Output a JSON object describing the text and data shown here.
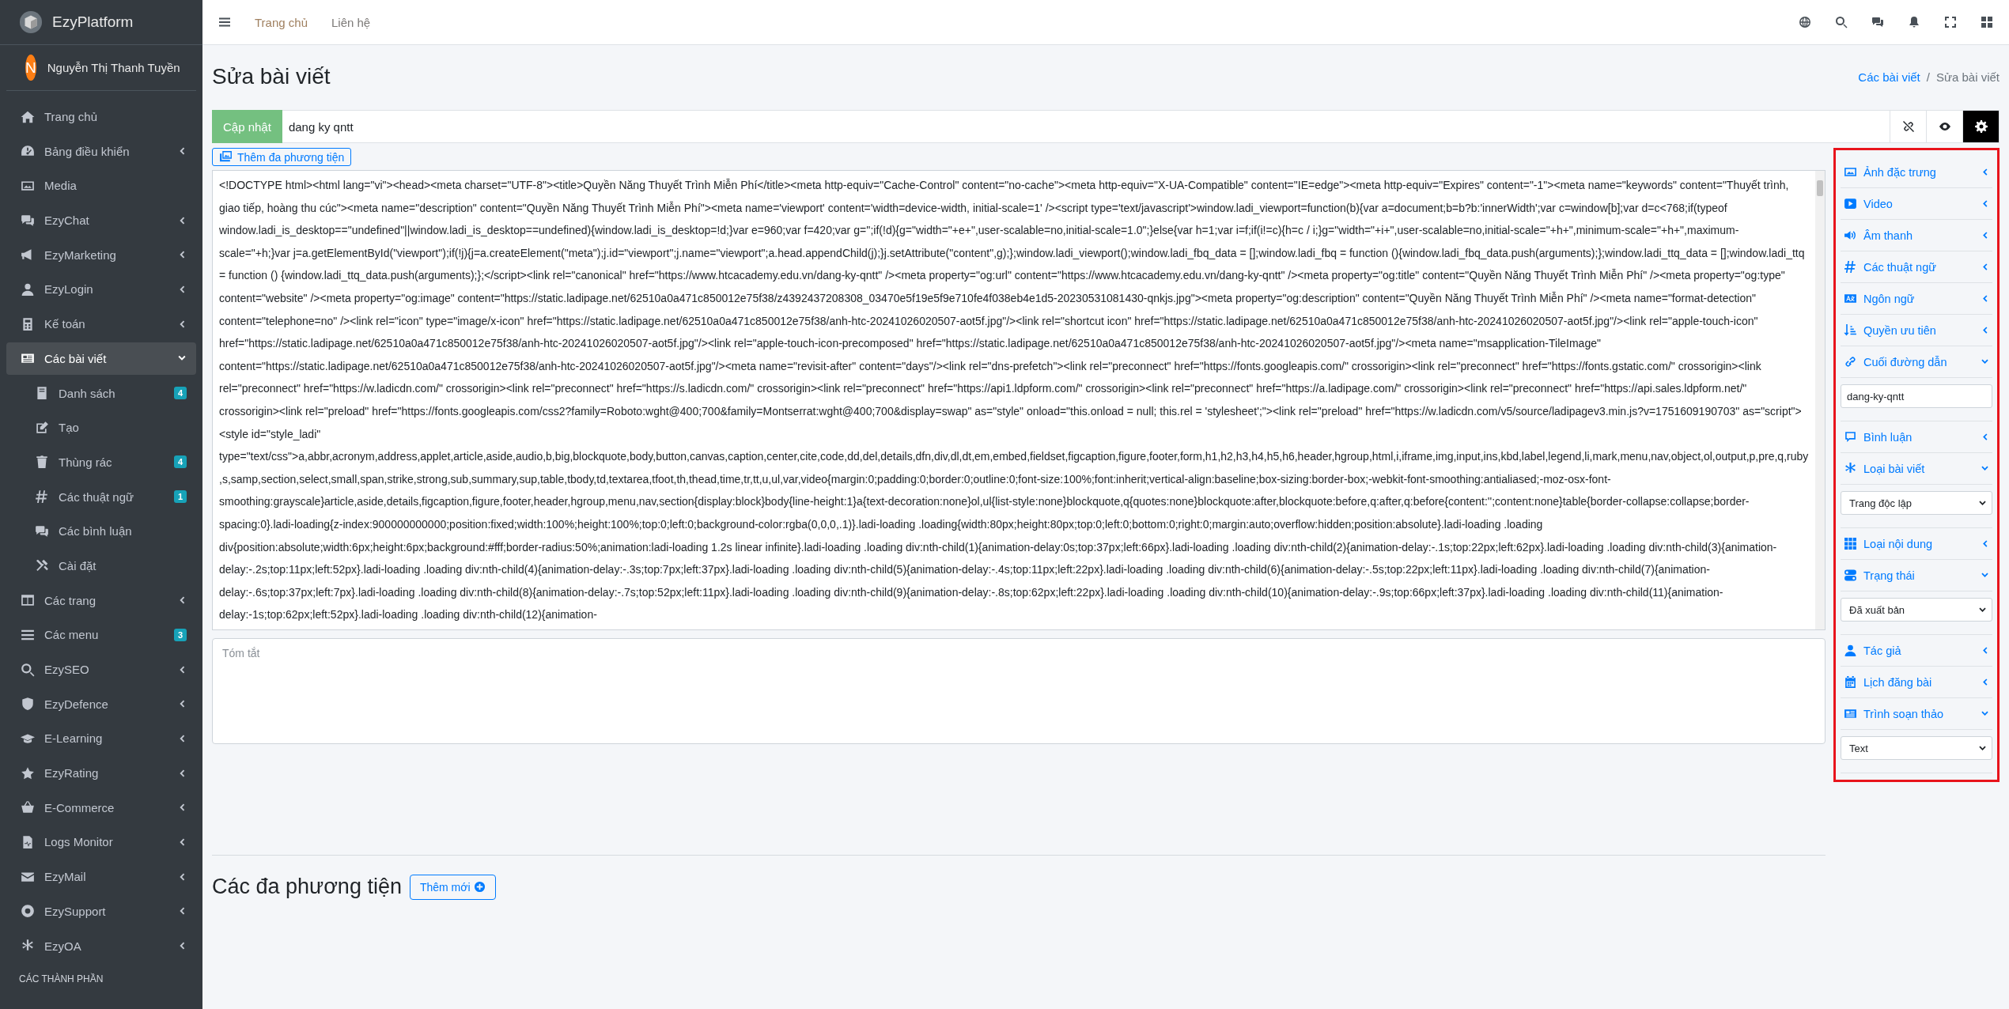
{
  "brand": {
    "name": "EzyPlatform"
  },
  "user": {
    "initial": "N",
    "name": "Nguyễn Thị Thanh Tuyền"
  },
  "sidebar": {
    "items": [
      {
        "label": "Trang chủ",
        "expandable": false,
        "expanded": false,
        "selected": false
      },
      {
        "label": "Bảng điều khiển",
        "expandable": true,
        "expanded": false,
        "selected": false
      },
      {
        "label": "Media",
        "expandable": false,
        "expanded": false,
        "selected": false
      },
      {
        "label": "EzyChat",
        "expandable": true,
        "expanded": false,
        "selected": false
      },
      {
        "label": "EzyMarketing",
        "expandable": true,
        "expanded": false,
        "selected": false
      },
      {
        "label": "EzyLogin",
        "expandable": true,
        "expanded": false,
        "selected": false
      },
      {
        "label": "Kế toán",
        "expandable": true,
        "expanded": false,
        "selected": false
      },
      {
        "label": "Các bài viết",
        "expandable": true,
        "expanded": true,
        "selected": true,
        "children": [
          {
            "label": "Danh sách",
            "badge": "4"
          },
          {
            "label": "Tạo"
          },
          {
            "label": "Thùng rác",
            "badge": "4"
          },
          {
            "label": "Các thuật ngữ",
            "badge": "1"
          },
          {
            "label": "Các bình luận"
          },
          {
            "label": "Cài đặt"
          }
        ]
      },
      {
        "label": "Các trang",
        "expandable": true,
        "expanded": false,
        "selected": false
      },
      {
        "label": "Các menu",
        "expandable": false,
        "expanded": false,
        "selected": false,
        "badge": "3"
      },
      {
        "label": "EzySEO",
        "expandable": true,
        "expanded": false,
        "selected": false
      },
      {
        "label": "EzyDefence",
        "expandable": true,
        "expanded": false,
        "selected": false
      },
      {
        "label": "E-Learning",
        "expandable": true,
        "expanded": false,
        "selected": false
      },
      {
        "label": "EzyRating",
        "expandable": true,
        "expanded": false,
        "selected": false
      },
      {
        "label": "E-Commerce",
        "expandable": true,
        "expanded": false,
        "selected": false
      },
      {
        "label": "Logs Monitor",
        "expandable": true,
        "expanded": false,
        "selected": false
      },
      {
        "label": "EzyMail",
        "expandable": true,
        "expanded": false,
        "selected": false
      },
      {
        "label": "EzySupport",
        "expandable": true,
        "expanded": false,
        "selected": false
      },
      {
        "label": "EzyOA",
        "expandable": true,
        "expanded": false,
        "selected": false
      }
    ],
    "section_header": "CÁC THÀNH PHẦN"
  },
  "topbar": {
    "links": [
      "Trang chủ",
      "Liên hệ"
    ]
  },
  "page": {
    "title": "Sửa bài viết",
    "breadcrumb_separator": "/",
    "breadcrumb": [
      {
        "label": "Các bài viết",
        "link": true
      },
      {
        "label": "Sửa bài viết",
        "link": false
      }
    ]
  },
  "toolbar": {
    "submit": "Cập nhật",
    "title_value": "dang ky qntt",
    "buttons": [
      {
        "selected": false
      },
      {
        "selected": false
      },
      {
        "selected": true
      }
    ]
  },
  "editor": {
    "add_media": "Thêm đa phương tiện",
    "content": "<!DOCTYPE html><html lang=\"vi\"><head><meta charset=\"UTF-8\"><title>Quyền Năng Thuyết Trình Miễn Phí</title><meta http-equiv=\"Cache-Control\" content=\"no-cache\"><meta http-equiv=\"X-UA-Compatible\" content=\"IE=edge\"><meta http-equiv=\"Expires\" content=\"-1\"><meta name=\"keywords\" content=\"Thuyết trình, giao tiếp, hoàng thu cúc\"><meta name=\"description\" content=\"Quyền Năng Thuyết Trình Miễn Phí\"><meta name='viewport' content='width=device-width, initial-scale=1' /><script type='text/javascript'>window.ladi_viewport=function(b){var a=document;b=b?b:'innerWidth';var c=window[b];var d=c<768;if(typeof window.ladi_is_desktop==\"undefined\"||window.ladi_is_desktop==undefined){window.ladi_is_desktop=!d;}var e=960;var f=420;var g='';if(!d){g=\"width=\"+e+\",user-scalable=no,initial-scale=1.0\";}else{var h=1;var i=f;if(i!=c){h=c / i;}g=\"width=\"+i+\",user-scalable=no,initial-scale=\"+h+\",minimum-scale=\"+h+\",maximum-scale=\"+h;}var j=a.getElementById(\"viewport\");if(!j){j=a.createElement(\"meta\");j.id=\"viewport\";j.name=\"viewport\";a.head.appendChild(j);}j.setAttribute(\"content\",g);};window.ladi_viewport();window.ladi_fbq_data = [];window.ladi_fbq = function (){window.ladi_fbq_data.push(arguments);};window.ladi_ttq_data = [];window.ladi_ttq = function () {window.ladi_ttq_data.push(arguments);};</script><link rel=\"canonical\" href=\"https://www.htcacademy.edu.vn/dang-ky-qntt\" /><meta property=\"og:url\" content=\"https://www.htcacademy.edu.vn/dang-ky-qntt\" /><meta property=\"og:title\" content=\"Quyền Năng Thuyết Trình Miễn Phí\" /><meta property=\"og:type\" content=\"website\" /><meta property=\"og:image\" content=\"https://static.ladipage.net/62510a0a471c850012e75f38/z4392437208308_03470e5f19e5f9e710fe4f038eb4e1d5-20230531081430-qnkjs.jpg\"><meta property=\"og:description\" content=\"Quyền Năng Thuyết Trình Miễn Phí\" /><meta name=\"format-detection\" content=\"telephone=no\" /><link rel=\"icon\" type=\"image/x-icon\" href=\"https://static.ladipage.net/62510a0a471c850012e75f38/anh-htc-20241026020507-aot5f.jpg\"/><link rel=\"shortcut icon\" href=\"https://static.ladipage.net/62510a0a471c850012e75f38/anh-htc-20241026020507-aot5f.jpg\"/><link rel=\"apple-touch-icon\" href=\"https://static.ladipage.net/62510a0a471c850012e75f38/anh-htc-20241026020507-aot5f.jpg\"/><link rel=\"apple-touch-icon-precomposed\" href=\"https://static.ladipage.net/62510a0a471c850012e75f38/anh-htc-20241026020507-aot5f.jpg\"/><meta name=\"msapplication-TileImage\" content=\"https://static.ladipage.net/62510a0a471c850012e75f38/anh-htc-20241026020507-aot5f.jpg\"/><meta name=\"revisit-after\" content=\"days\"/><link rel=\"dns-prefetch\"><link rel=\"preconnect\" href=\"https://fonts.googleapis.com/\" crossorigin><link rel=\"preconnect\" href=\"https://fonts.gstatic.com/\" crossorigin><link rel=\"preconnect\" href=\"https://w.ladicdn.com/\" crossorigin><link rel=\"preconnect\" href=\"https://s.ladicdn.com/\" crossorigin><link rel=\"preconnect\" href=\"https://api1.ldpform.com/\" crossorigin><link rel=\"preconnect\" href=\"https://a.ladipage.com/\" crossorigin><link rel=\"preconnect\" href=\"https://api.sales.ldpform.net/\" crossorigin><link rel=\"preload\" href=\"https://fonts.googleapis.com/css2?family=Roboto:wght@400;700&family=Montserrat:wght@400;700&display=swap\" as=\"style\" onload=\"this.onload = null; this.rel = 'stylesheet';\"><link rel=\"preload\" href=\"https://w.ladicdn.com/v5/source/ladipagev3.min.js?v=1751609190703\" as=\"script\"><style id=\"style_ladi\" type=\"text/css\">a,abbr,acronym,address,applet,article,aside,audio,b,big,blockquote,body,button,canvas,caption,center,cite,code,dd,del,details,dfn,div,dl,dt,em,embed,fieldset,figcaption,figure,footer,form,h1,h2,h3,h4,h5,h6,header,hgroup,html,i,iframe,img,input,ins,kbd,label,legend,li,mark,menu,nav,object,ol,output,p,pre,q,ruby,s,samp,section,select,small,span,strike,strong,sub,summary,sup,table,tbody,td,textarea,tfoot,th,thead,time,tr,tt,u,ul,var,video{margin:0;padding:0;border:0;outline:0;font-size:100%;font:inherit;vertical-align:baseline;box-sizing:border-box;-webkit-font-smoothing:antialiased;-moz-osx-font-smoothing:grayscale}article,aside,details,figcaption,figure,footer,header,hgroup,menu,nav,section{display:block}body{line-height:1}a{text-decoration:none}ol,ul{list-style:none}blockquote,q{quotes:none}blockquote:after,blockquote:before,q:after,q:before{content:'';content:none}table{border-collapse:collapse;border-spacing:0}.ladi-loading{z-index:900000000000;position:fixed;width:100%;height:100%;top:0;left:0;background-color:rgba(0,0,0,.1)}.ladi-loading .loading{width:80px;height:80px;top:0;left:0;bottom:0;right:0;margin:auto;overflow:hidden;position:absolute}.ladi-loading .loading div{position:absolute;width:6px;height:6px;background:#fff;border-radius:50%;animation:ladi-loading 1.2s linear infinite}.ladi-loading .loading div:nth-child(1){animation-delay:0s;top:37px;left:66px}.ladi-loading .loading div:nth-child(2){animation-delay:-.1s;top:22px;left:62px}.ladi-loading .loading div:nth-child(3){animation-delay:-.2s;top:11px;left:52px}.ladi-loading .loading div:nth-child(4){animation-delay:-.3s;top:7px;left:37px}.ladi-loading .loading div:nth-child(5){animation-delay:-.4s;top:11px;left:22px}.ladi-loading .loading div:nth-child(6){animation-delay:-.5s;top:22px;left:11px}.ladi-loading .loading div:nth-child(7){animation-delay:-.6s;top:37px;left:7px}.ladi-loading .loading div:nth-child(8){animation-delay:-.7s;top:52px;left:11px}.ladi-loading .loading div:nth-child(9){animation-delay:-.8s;top:62px;left:22px}.ladi-loading .loading div:nth-child(10){animation-delay:-.9s;top:66px;left:37px}.ladi-loading .loading div:nth-child(11){animation-delay:-1s;top:62px;left:52px}.ladi-loading .loading div:nth-child(12){animation-",
    "summary_placeholder": "Tóm tắt"
  },
  "right_panel": {
    "highlighted": true,
    "sections": [
      {
        "label": "Ảnh đặc trưng",
        "expanded": false
      },
      {
        "label": "Video",
        "expanded": false
      },
      {
        "label": "Âm thanh",
        "expanded": false
      },
      {
        "label": "Các thuật ngữ",
        "expanded": false
      },
      {
        "label": "Ngôn ngữ",
        "expanded": false
      },
      {
        "label": "Quyền ưu tiên",
        "expanded": false
      },
      {
        "label": "Cuối đường dẫn",
        "expanded": true,
        "field": {
          "kind": "input",
          "value": "dang-ky-qntt"
        }
      },
      {
        "label": "Bình luận",
        "expanded": false
      },
      {
        "label": "Loại bài viết",
        "expanded": true,
        "field": {
          "kind": "select",
          "value": "Trang độc lập"
        }
      },
      {
        "label": "Loại nội dung",
        "expanded": false
      },
      {
        "label": "Trạng thái",
        "expanded": true,
        "field": {
          "kind": "select",
          "value": "Đã xuất bản"
        }
      },
      {
        "label": "Tác giả",
        "expanded": false
      },
      {
        "label": "Lịch đăng bài",
        "expanded": false
      },
      {
        "label": "Trình soạn thảo",
        "expanded": true,
        "field": {
          "kind": "select",
          "value": "Text"
        }
      }
    ]
  },
  "media": {
    "title": "Các đa phương tiện",
    "add_button": "Thêm mới"
  }
}
